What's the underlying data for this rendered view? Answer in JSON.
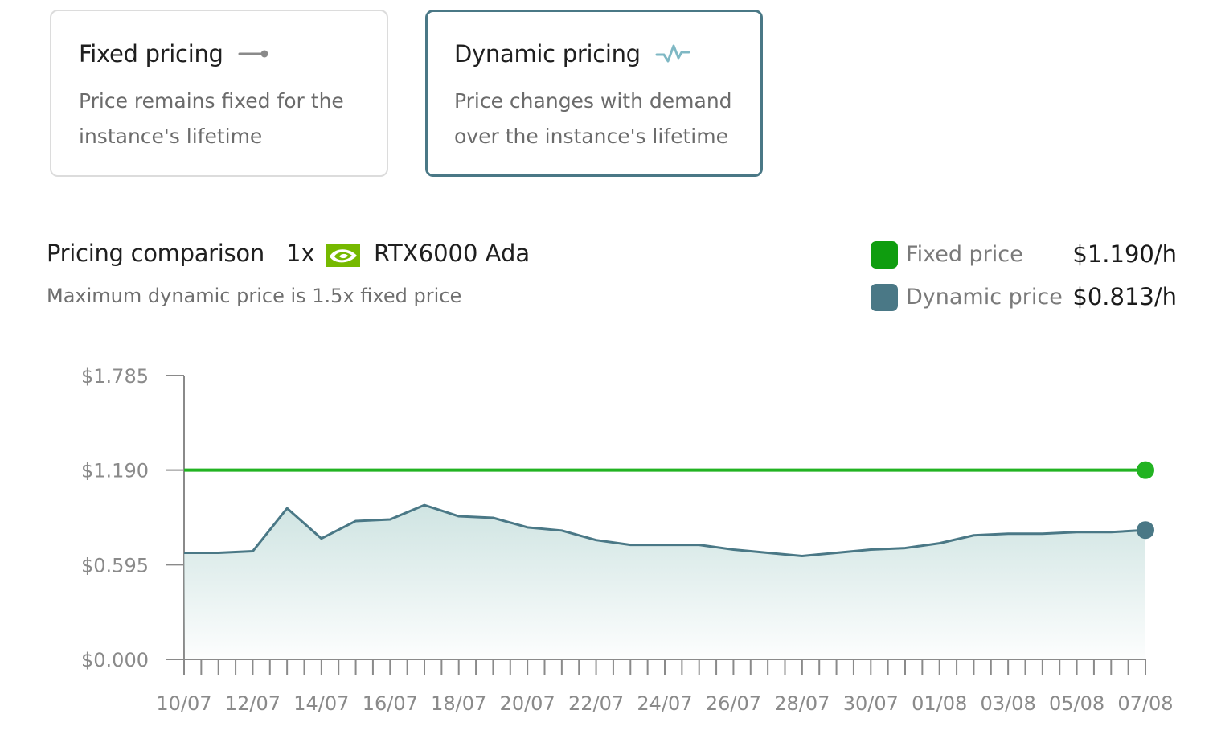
{
  "pricing_options": {
    "fixed": {
      "title": "Fixed pricing",
      "description": "Price remains fixed for the instance's lifetime",
      "icon": "fixed-line-icon"
    },
    "dynamic": {
      "title": "Dynamic pricing",
      "description": "Price changes with demand over the instance's lifetime",
      "icon": "pulse-icon",
      "selected": true
    }
  },
  "comparison": {
    "title": "Pricing comparison",
    "gpu_count": "1x",
    "gpu_logo": "nvidia-logo-icon",
    "gpu_name": "RTX6000 Ada",
    "subtitle": "Maximum dynamic price is 1.5x fixed price"
  },
  "legend": [
    {
      "label": "Fixed price",
      "value": "$1.190/h",
      "color": "#0f9d0f"
    },
    {
      "label": "Dynamic price",
      "value": "$0.813/h",
      "color": "#4a7886"
    }
  ],
  "colors": {
    "fixed": "#22b322",
    "dynamic": "#4a7886",
    "area_top": "#cfe4e2",
    "axis": "#8a8a8a",
    "nvidia": "#76b900"
  },
  "chart_data": {
    "type": "line",
    "title": "",
    "xlabel": "",
    "ylabel": "",
    "ylim": [
      0,
      1.785
    ],
    "y_ticks": [
      "$1.785",
      "$1.190",
      "$0.595",
      "$0.000"
    ],
    "y_tick_values": [
      1.785,
      1.19,
      0.595,
      0.0
    ],
    "x_tick_labels": [
      "10/07",
      "12/07",
      "14/07",
      "16/07",
      "18/07",
      "20/07",
      "22/07",
      "24/07",
      "26/07",
      "28/07",
      "30/07",
      "01/08",
      "03/08",
      "05/08",
      "07/08"
    ],
    "x_start": "2024-07-10",
    "x_end": "2024-08-07",
    "grid": false,
    "series": [
      {
        "name": "Fixed price",
        "x": [
          "10/07",
          "07/08"
        ],
        "values": [
          1.19,
          1.19
        ]
      },
      {
        "name": "Dynamic price",
        "x": [
          "10/07",
          "11/07",
          "12/07",
          "13/07",
          "14/07",
          "15/07",
          "16/07",
          "17/07",
          "18/07",
          "19/07",
          "20/07",
          "21/07",
          "22/07",
          "23/07",
          "24/07",
          "25/07",
          "26/07",
          "27/07",
          "28/07",
          "29/07",
          "30/07",
          "31/07",
          "01/08",
          "02/08",
          "03/08",
          "04/08",
          "05/08",
          "06/08",
          "07/08"
        ],
        "values": [
          0.67,
          0.67,
          0.68,
          0.95,
          0.76,
          0.87,
          0.88,
          0.97,
          0.9,
          0.89,
          0.83,
          0.81,
          0.75,
          0.72,
          0.72,
          0.72,
          0.69,
          0.67,
          0.65,
          0.67,
          0.69,
          0.7,
          0.73,
          0.78,
          0.79,
          0.79,
          0.8,
          0.8,
          0.813
        ]
      }
    ]
  }
}
